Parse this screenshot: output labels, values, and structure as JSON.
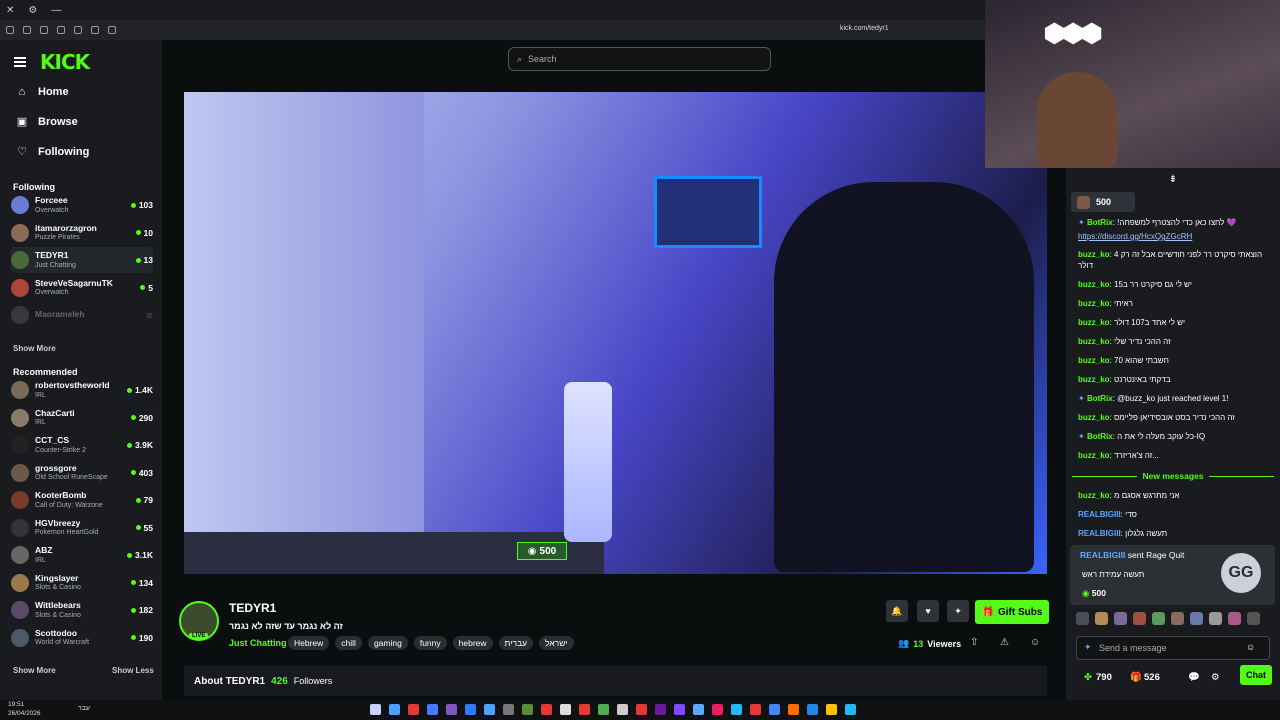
{
  "os": {
    "close": "✕",
    "cog": "⚙",
    "min": "—"
  },
  "browser": {
    "url": "kick.com/tedyr1"
  },
  "sidebar": {
    "logo": "KICK",
    "nav": [
      {
        "label": "Home",
        "icon": "⌂"
      },
      {
        "label": "Browse",
        "icon": "▣"
      },
      {
        "label": "Following",
        "icon": "♡"
      }
    ],
    "following_title": "Following",
    "following": [
      {
        "name": "Forceee",
        "category": "Overwatch",
        "viewers": "103",
        "color": "#6a7bd6"
      },
      {
        "name": "itamarorzagron",
        "category": "Puzzle Pirates",
        "viewers": "10",
        "color": "#8a6b55"
      },
      {
        "name": "TEDYR1",
        "category": "Just Chatting",
        "viewers": "13",
        "color": "#4b6a3c"
      },
      {
        "name": "SteveVeSagarnuTK",
        "category": "Overwatch",
        "viewers": "5",
        "color": "#b0453a"
      },
      {
        "name": "Maorameleh",
        "category": "",
        "viewers": "",
        "color": "#555"
      }
    ],
    "show_more": "Show More",
    "recommended_title": "Recommended",
    "recommended": [
      {
        "name": "robertovstheworld",
        "category": "IRL",
        "viewers": "1.4K",
        "color": "#7a6a5a"
      },
      {
        "name": "ChazCarti",
        "category": "IRL",
        "viewers": "290",
        "color": "#8b7b6b"
      },
      {
        "name": "CCT_CS",
        "category": "Counter-Strike 2",
        "viewers": "3.9K",
        "color": "#222"
      },
      {
        "name": "grossgore",
        "category": "Old School RuneScape",
        "viewers": "403",
        "color": "#6b5a4a"
      },
      {
        "name": "KooterBomb",
        "category": "Call of Duty: Warzone",
        "viewers": "79",
        "color": "#7a3a2a"
      },
      {
        "name": "HGVbreezy",
        "category": "Pokemon HeartGold",
        "viewers": "55",
        "color": "#333"
      },
      {
        "name": "ABZ",
        "category": "IRL",
        "viewers": "3.1K",
        "color": "#666"
      },
      {
        "name": "Kingslayer",
        "category": "Slots & Casino",
        "viewers": "134",
        "color": "#9a7a4a"
      },
      {
        "name": "Wittlebears",
        "category": "Slots & Casino",
        "viewers": "182",
        "color": "#5a4a6a"
      },
      {
        "name": "Scottodoo",
        "category": "World of Warcraft",
        "viewers": "190",
        "color": "#4a5a6a"
      }
    ],
    "show_less_left": "Show More",
    "show_less": "Show Less"
  },
  "search": {
    "placeholder": "Search"
  },
  "video": {
    "points": "500"
  },
  "streamer": {
    "name": "TEDYR1",
    "title": "זה לא נגמר עד שזה לא נגמר",
    "category": "Just Chatting",
    "live": "LIVE",
    "tags": [
      "Hebrew",
      "chill",
      "gaming",
      "funny",
      "hebrew",
      "עברית",
      "ישראל"
    ],
    "viewers_count": "13",
    "viewers_label": "Viewers",
    "gift_label": "Gift Subs",
    "about_label": "About TEDYR1",
    "followers_count": "426",
    "followers_label": "Followers"
  },
  "chat": {
    "pinned_points": "500",
    "messages": [
      {
        "user": "BotRix",
        "text": "!לחצו כאן כדי להצטרף למשפחה 💜",
        "bot": true
      },
      {
        "user": "",
        "text": "https://discord.gg/HcxQgZGcRH",
        "link": true
      },
      {
        "user": "buzz_ko",
        "text": "הוצאתי סיקרט רר לפני חודשיים אבל זה רק 4 דולר"
      },
      {
        "user": "buzz_ko",
        "text": "יש לי גם סיקרט רר ב15"
      },
      {
        "user": "buzz_ko",
        "text": "ראיתי"
      },
      {
        "user": "buzz_ko",
        "text": "יש לי אחד ב107 דולר"
      },
      {
        "user": "buzz_ko",
        "text": "זה ההכי נדיר שלי"
      },
      {
        "user": "buzz_ko",
        "text": "חשבתי שהוא 70"
      },
      {
        "user": "buzz_ko",
        "text": "בדקתי באינטרנט"
      },
      {
        "user": "BotRix",
        "text": "@buzz_ko just reached level 1!",
        "bot": true
      },
      {
        "user": "buzz_ko",
        "text": "זה ההכי נדיר בסט אובסידיאן פליימס"
      },
      {
        "user": "BotRix",
        "text": "כל עוקב מעלה לי את ה-IQ",
        "bot": true
      },
      {
        "user": "buzz_ko",
        "text": "זה צ'אריזרד..."
      }
    ],
    "new_messages": "New messages",
    "new": [
      {
        "user": "buzz_ko",
        "text": "אני מתרגש אסגם מ",
        "blue": false
      },
      {
        "user": "REALBIGIII",
        "text": "סדי",
        "blue": true
      },
      {
        "user": "REALBIGIII",
        "text": "תעשה גלגלון",
        "blue": true
      }
    ],
    "raid": {
      "user": "REALBIGIII",
      "action": "sent Rage Quit",
      "message": "תעשה עמידת ראש",
      "points": "500",
      "badge": "GG"
    },
    "input_placeholder": "Send a message",
    "footer": {
      "points": "790",
      "gifts": "526",
      "chat_btn": "Chat"
    }
  },
  "webcam": {
    "overlay": "⬢⬢⬢"
  },
  "taskbar": {
    "time": "19:51",
    "date": "26/04/2026",
    "lang": "עבר"
  }
}
